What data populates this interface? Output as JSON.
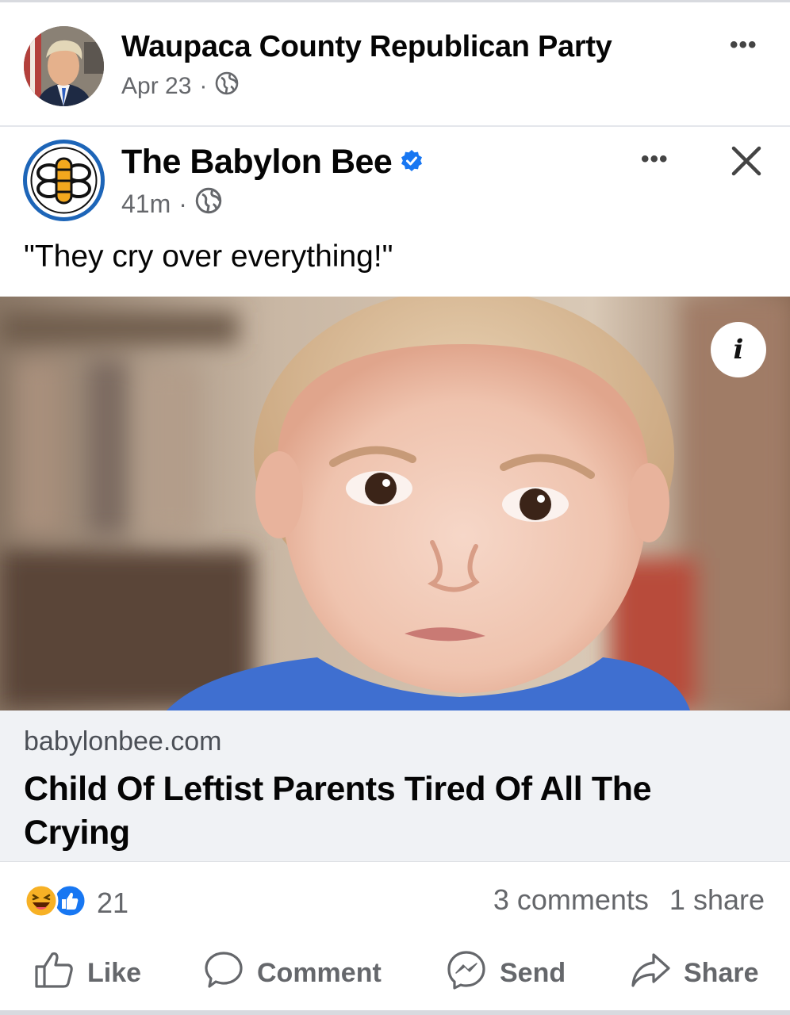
{
  "outer_post": {
    "author": "Waupaca County Republican Party",
    "date": "Apr 23",
    "separator": "·",
    "privacy_icon": "globe-icon",
    "more_icon": "more-options-icon",
    "more_label": "•••"
  },
  "shared_post": {
    "author": "The Babylon Bee",
    "verified_icon": "verified-badge-icon",
    "time": "41m",
    "separator": "·",
    "privacy_icon": "globe-icon",
    "more_label": "•••",
    "close_icon": "close-icon",
    "caption": "\"They cry over everything!\""
  },
  "image": {
    "info_label": "i"
  },
  "link_preview": {
    "domain": "babylonbee.com",
    "title": "Child Of Leftist Parents Tired Of All The Crying"
  },
  "engagement": {
    "reaction_icons": [
      "haha-reaction-icon",
      "like-reaction-icon"
    ],
    "reaction_count": "21",
    "comments": "3 comments",
    "shares": "1 share"
  },
  "actions": {
    "like": "Like",
    "comment": "Comment",
    "send": "Send",
    "share": "Share"
  },
  "colors": {
    "facebook_blue": "#1877f2",
    "secondary_text": "#65676b",
    "link_card_bg": "#f0f2f5",
    "haha_yellow": "#f7b125"
  }
}
